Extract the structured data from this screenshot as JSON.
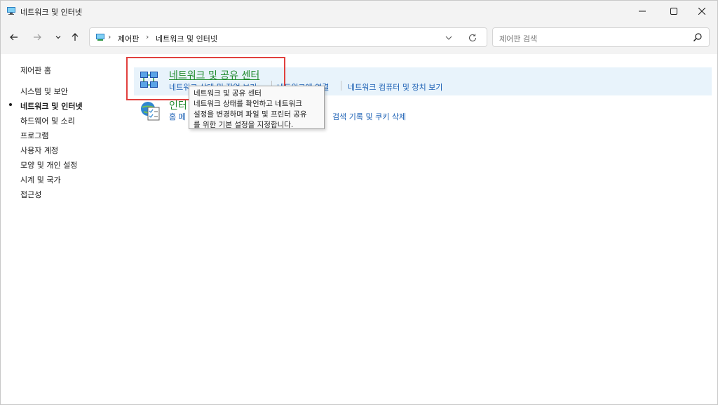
{
  "window": {
    "title": "네트워크 및 인터넷"
  },
  "address": {
    "crumbs": [
      "제어판",
      "네트워크 및 인터넷"
    ],
    "separator": "›"
  },
  "search": {
    "placeholder": "제어판 검색"
  },
  "sidebar": {
    "home": "제어판 홈",
    "items": [
      {
        "label": "시스템 및 보안"
      },
      {
        "label": "네트워크 및 인터넷",
        "active": true
      },
      {
        "label": "하드웨어 및 소리"
      },
      {
        "label": "프로그램"
      },
      {
        "label": "사용자 계정"
      },
      {
        "label": "모양 및 개인 설정"
      },
      {
        "label": "시계 및 국가"
      },
      {
        "label": "접근성"
      }
    ]
  },
  "categories": [
    {
      "title": "네트워크 및 공유 센터",
      "links": [
        "네트워크 상태 및 작업 보기",
        "네트워크에 연결",
        "네트워크 컴퓨터 및 장치 보기"
      ]
    },
    {
      "title": "인터",
      "links": [
        "홈 페",
        "검색 기록 및 쿠키 삭제"
      ]
    }
  ],
  "tooltip": {
    "lines": [
      "네트워크 및 공유 센터",
      "네트워크 상태를 확인하고 네트워크",
      "설정을 변경하며 파일 및 프린터 공유",
      "를 위한 기본 설정을 지정합니다."
    ]
  },
  "colors": {
    "link": "#1a5fb4",
    "category_title": "#1f8a2c",
    "highlight": "#e1403e",
    "hover_row": "#e8f3fb"
  }
}
